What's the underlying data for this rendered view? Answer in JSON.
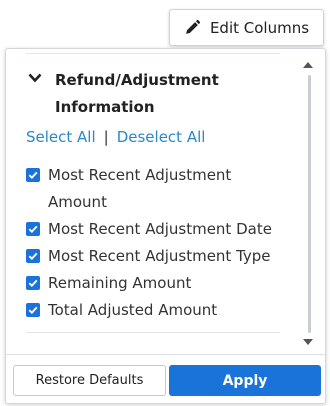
{
  "header": {
    "edit_columns_label": "Edit Columns",
    "icon": "pencil-icon"
  },
  "section": {
    "title": "Refund/Adjustment Information",
    "expanded": true,
    "select_all": "Select All",
    "separator": "|",
    "deselect_all": "Deselect All",
    "options": [
      {
        "label": "Most Recent Adjustment Amount",
        "checked": true
      },
      {
        "label": "Most Recent Adjustment Date",
        "checked": true
      },
      {
        "label": "Most Recent Adjustment Type",
        "checked": true
      },
      {
        "label": "Remaining Amount",
        "checked": true
      },
      {
        "label": "Total Adjusted Amount",
        "checked": true
      }
    ]
  },
  "footer": {
    "restore_label": "Restore Defaults",
    "apply_label": "Apply"
  },
  "colors": {
    "accent": "#1a73d8",
    "link": "#2a87c8"
  }
}
